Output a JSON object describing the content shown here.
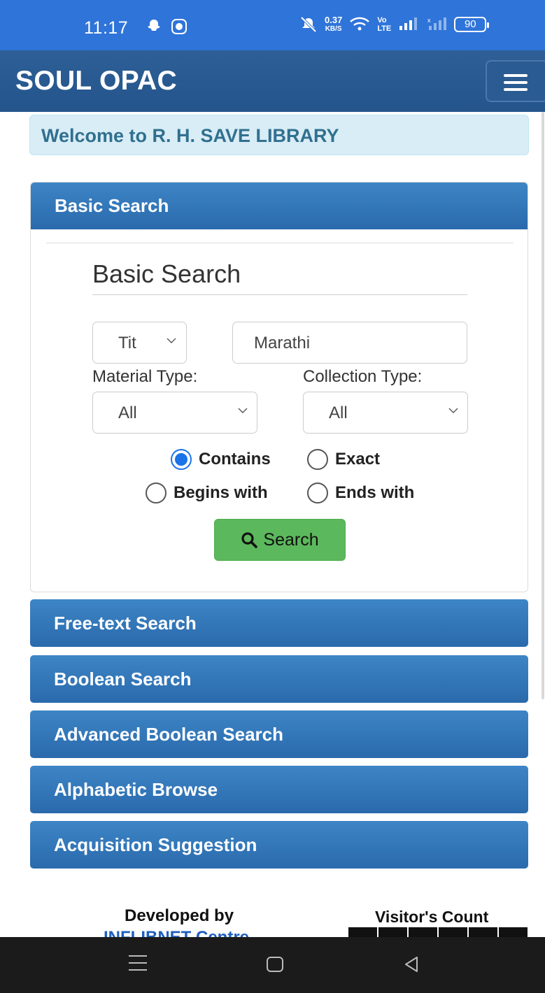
{
  "status_bar": {
    "time": "11:17",
    "net_speed_value": "0.37",
    "net_speed_unit": "KB/S",
    "volte_top": "Vo",
    "volte_bottom": "LTE",
    "battery": "90"
  },
  "navbar": {
    "brand": "SOUL OPAC",
    "menu_icon": "hamburger-menu-icon"
  },
  "welcome": "Welcome to R. H. SAVE LIBRARY",
  "basic_search_panel": {
    "header": "Basic Search",
    "form_title": "Basic Search",
    "field_select": "Tit",
    "search_value": "Marathi",
    "material_type_label": "Material Type:",
    "material_type_value": "All",
    "collection_type_label": "Collection Type:",
    "collection_type_value": "All",
    "match_options": [
      {
        "label": "Contains",
        "checked": true
      },
      {
        "label": "Exact",
        "checked": false
      },
      {
        "label": "Begins with",
        "checked": false
      },
      {
        "label": "Ends with",
        "checked": false
      }
    ],
    "search_button": "Search"
  },
  "accordion": [
    "Free-text Search",
    "Boolean Search",
    "Advanced Boolean Search",
    "Alphabetic Browse",
    "Acquisition Suggestion"
  ],
  "footer": {
    "developed_by": "Developed by",
    "developer_link": "INFLIBNET Centre",
    "visitor_count_label": "Visitor's Count"
  },
  "colors": {
    "status_bar": "#2f74d9",
    "navbar": "#2e5f96",
    "panel_header": "#3d85c6",
    "search_button": "#5cb85c",
    "radio_checked": "#1a73e8"
  }
}
